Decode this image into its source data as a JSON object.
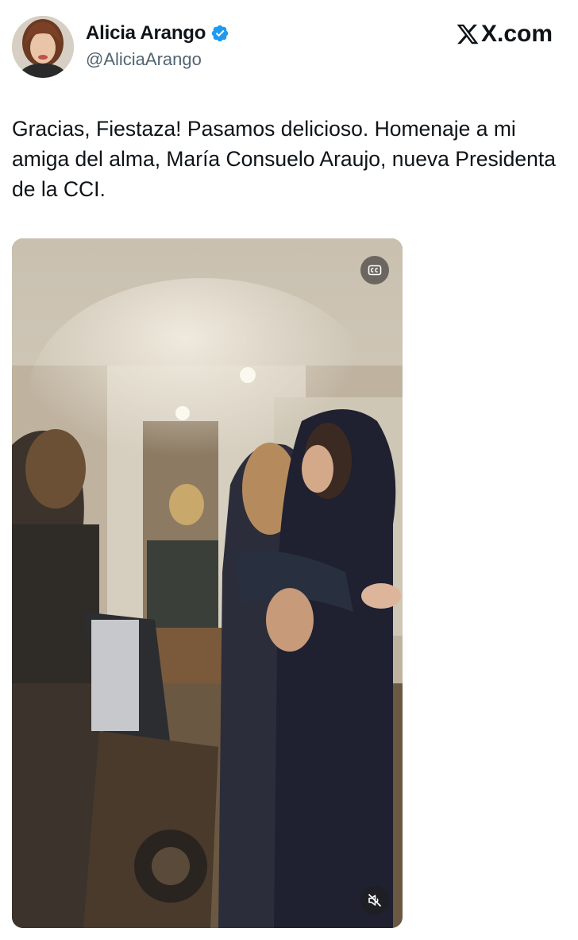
{
  "tweet": {
    "author": {
      "display_name": "Alicia Arango",
      "handle": "@AliciaArango",
      "verified": true
    },
    "brand": "X.com",
    "text": "Gracias, Fiestaza! Pasamos delicioso. Homenaje a mi amiga del alma, María Consuelo Araujo, nueva Presidenta de la CCI.",
    "media": {
      "type": "video",
      "controls": {
        "captions_icon": "cc-icon",
        "sound_icon": "muted-speaker-icon"
      }
    }
  },
  "colors": {
    "verified_blue": "#1d9bf0",
    "text": "#0f1419",
    "secondary_text": "#536471"
  }
}
